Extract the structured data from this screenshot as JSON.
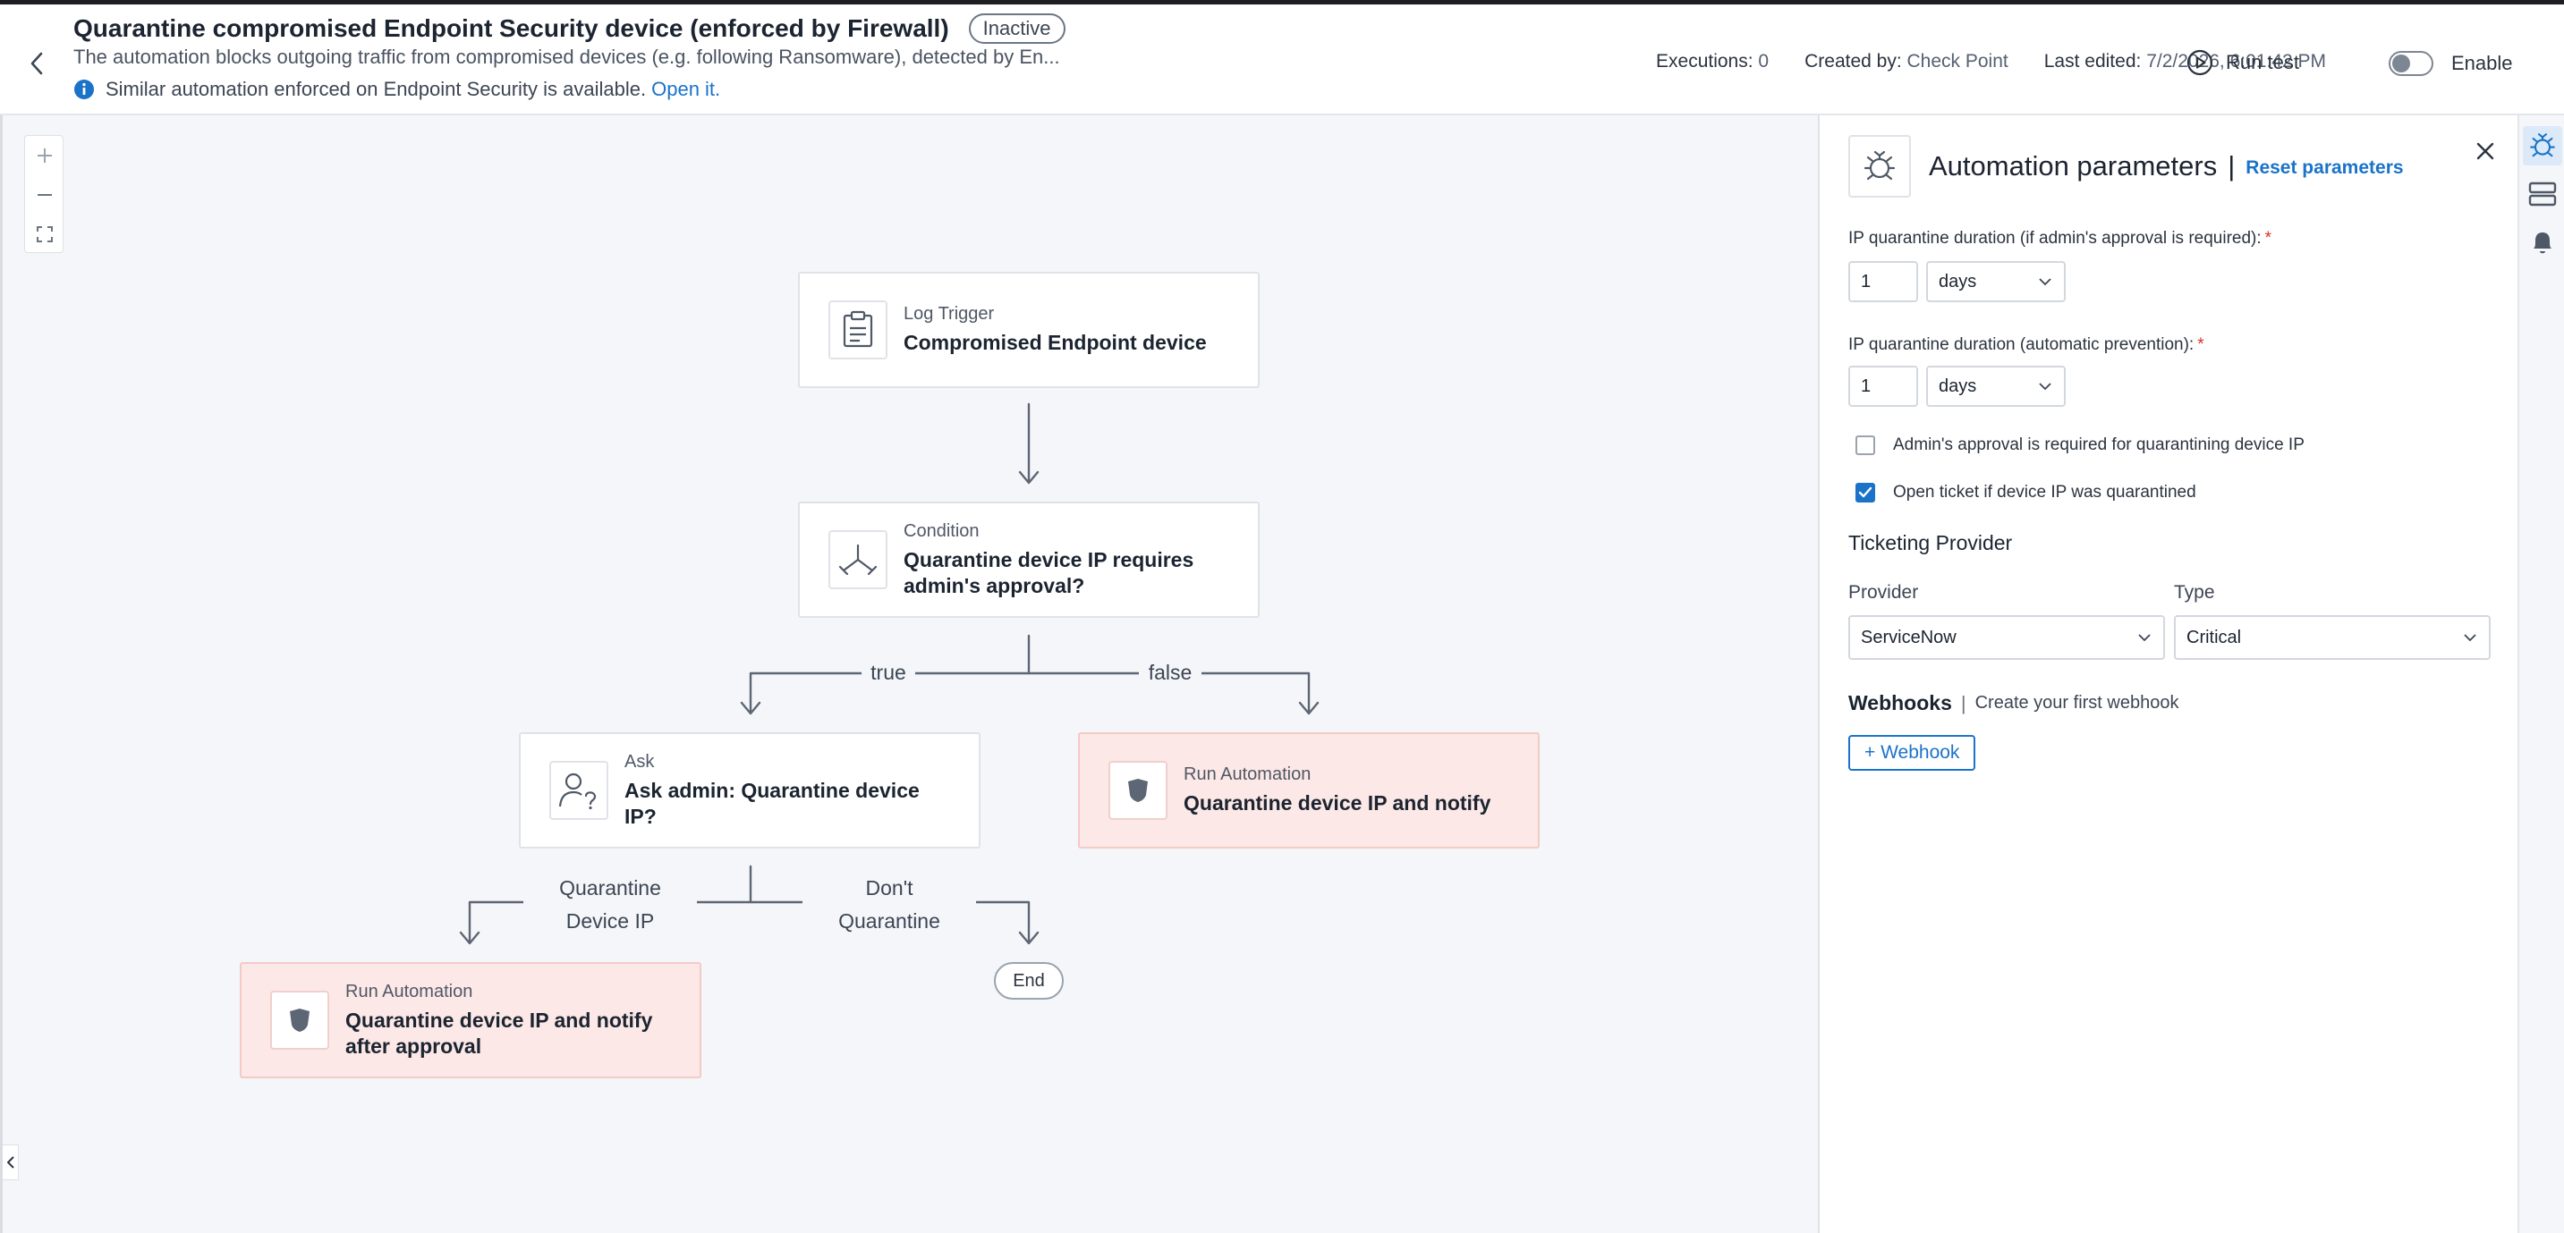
{
  "header": {
    "title": "Quarantine compromised Endpoint Security device (enforced by Firewall)",
    "status": "Inactive",
    "description": "The automation blocks outgoing traffic from compromised devices (e.g. following Ransomware), detected by En...",
    "info_text": "Similar automation enforced on Endpoint Security is available.",
    "info_link": "Open it.",
    "executions_label": "Executions:",
    "executions_value": "0",
    "created_label": "Created by:",
    "created_value": "Check Point",
    "edited_label": "Last edited:",
    "edited_value": "7/2/2026, 6:01:42 PM",
    "run_test": "Run test",
    "enable": "Enable"
  },
  "canvas": {
    "zoom_in": "+",
    "zoom_out": "—",
    "nodes": {
      "trigger": {
        "type": "Log Trigger",
        "name": "Compromised Endpoint device"
      },
      "condition": {
        "type": "Condition",
        "name": "Quarantine device IP requires admin's approval?"
      },
      "ask": {
        "type": "Ask",
        "name": "Ask admin: Quarantine device IP?"
      },
      "run_right": {
        "type": "Run Automation",
        "name": "Quarantine device IP and notify"
      },
      "run_left": {
        "type": "Run Automation",
        "name": "Quarantine device IP and notify after approval"
      },
      "end": "End"
    },
    "edges": {
      "true": "true",
      "false": "false",
      "quarantine_1": "Quarantine",
      "quarantine_2": "Device IP",
      "dont_1": "Don't",
      "dont_2": "Quarantine"
    }
  },
  "panel": {
    "title": "Automation parameters",
    "separator": "|",
    "reset": "Reset parameters",
    "field1_label": "IP quarantine duration (if admin's approval is required):",
    "field1_value": "1",
    "field1_unit": "days",
    "field2_label": "IP quarantine duration (automatic prevention):",
    "field2_value": "1",
    "field2_unit": "days",
    "required_mark": "*",
    "check1_label": "Admin's approval is required for quarantining device IP",
    "check1_checked": false,
    "check2_label": "Open ticket if device IP was quarantined",
    "check2_checked": true,
    "ticketing_title": "Ticketing Provider",
    "provider_label": "Provider",
    "provider_value": "ServiceNow",
    "type_label": "Type",
    "type_value": "Critical",
    "webhooks_title": "Webhooks",
    "webhooks_sep": "|",
    "webhooks_link": "Create your first webhook",
    "add_webhook": "+ Webhook"
  },
  "colors": {
    "accent": "#1a73c9",
    "run_node_bg": "#fce8e6",
    "canvas_bg": "#f4f6f9",
    "required": "#d93025"
  }
}
